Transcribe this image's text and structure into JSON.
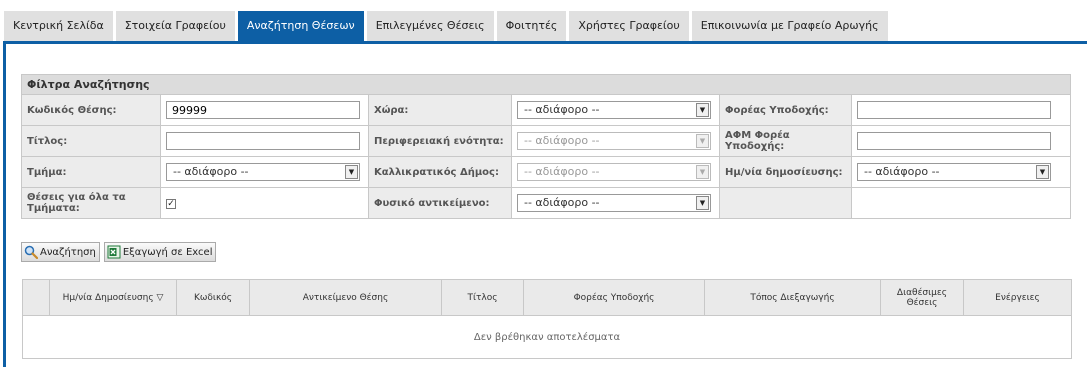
{
  "tabs": [
    {
      "label": "Κεντρική Σελίδα",
      "active": false
    },
    {
      "label": "Στοιχεία Γραφείου",
      "active": false
    },
    {
      "label": "Αναζήτηση Θέσεων",
      "active": true
    },
    {
      "label": "Επιλεγμένες Θέσεις",
      "active": false
    },
    {
      "label": "Φοιτητές",
      "active": false
    },
    {
      "label": "Χρήστες Γραφείου",
      "active": false
    },
    {
      "label": "Επικοινωνία με Γραφείο Αρωγής",
      "active": false
    }
  ],
  "filters": {
    "title": "Φίλτρα Αναζήτησης",
    "position_code": {
      "label": "Κωδικός Θέσης:",
      "value": "99999"
    },
    "country": {
      "label": "Χώρα:",
      "value": "-- αδιάφορο --"
    },
    "host_entity": {
      "label": "Φορέας Υποδοχής:",
      "value": ""
    },
    "title_field": {
      "label": "Τίτλος:",
      "value": ""
    },
    "regional_unit": {
      "label": "Περιφερειακή ενότητα:",
      "value": "-- αδιάφορο --"
    },
    "host_afm": {
      "label": "ΑΦΜ Φορέα Υποδοχής:",
      "value": ""
    },
    "department": {
      "label": "Τμήμα:",
      "value": "-- αδιάφορο --"
    },
    "municipality": {
      "label": "Καλλικρατικός Δήμος:",
      "value": "-- αδιάφορο --"
    },
    "publish_date": {
      "label": "Ημ/νία δημοσίευσης:",
      "value": "-- αδιάφορο --"
    },
    "all_departments": {
      "label": "Θέσεις για όλα τα Τμήματα:",
      "checked": true,
      "mark": "✓"
    },
    "physical_object": {
      "label": "Φυσικό αντικείμενο:",
      "value": "-- αδιάφορο --"
    }
  },
  "buttons": {
    "search": "Αναζήτηση",
    "export": "Εξαγωγή σε Excel"
  },
  "results": {
    "columns": [
      "",
      "Ημ/νία Δημοσίευσης ▽",
      "Κωδικός",
      "Αντικείμενο Θέσης",
      "Τίτλος",
      "Φορέας Υποδοχής",
      "Τόπος Διεξαγωγής",
      "Διαθέσιμες Θέσεις",
      "Ενέργειες"
    ],
    "empty_message": "Δεν βρέθηκαν αποτελέσματα"
  },
  "colors": {
    "accent": "#0d5fa5",
    "tab_inactive": "#e0e0e0",
    "header_bg": "#dcdcdc",
    "label_bg": "#ececec"
  },
  "icons": {
    "dropdown": "chevron-down-icon",
    "search": "magnifier-icon",
    "export": "excel-icon",
    "sort": "sort-icon"
  }
}
